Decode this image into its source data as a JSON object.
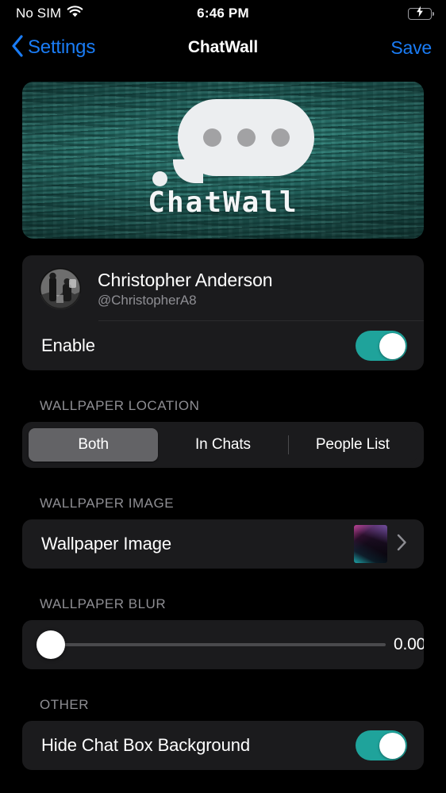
{
  "status_bar": {
    "carrier": "No SIM",
    "time": "6:46 PM",
    "wifi_icon": "wifi-icon",
    "battery_icon": "battery-charging-icon"
  },
  "nav": {
    "back_icon": "chevron-left-icon",
    "back_label": "Settings",
    "title": "ChatWall",
    "save_label": "Save"
  },
  "banner": {
    "wordmark": "ChatWall",
    "bubble_icon": "speech-bubble-icon",
    "dots": [
      "",
      "",
      ""
    ]
  },
  "account": {
    "avatar_icon": "avatar",
    "name": "Christopher Anderson",
    "handle": "@ChristopherA8",
    "enable_label": "Enable",
    "enable_on": true
  },
  "sections": {
    "wallpaper_location": {
      "header": "WALLPAPER LOCATION",
      "options": [
        "Both",
        "In Chats",
        "People List"
      ],
      "selected": "Both"
    },
    "wallpaper_image": {
      "header": "WALLPAPER IMAGE",
      "row_label": "Wallpaper Image",
      "thumbnail_icon": "wallpaper-thumbnail",
      "disclosure_icon": "chevron-right-icon"
    },
    "wallpaper_blur": {
      "header": "WALLPAPER BLUR",
      "value": "0.00",
      "slider_percent": 0
    },
    "other": {
      "header": "OTHER",
      "hide_chat_box_label": "Hide Chat Box Background",
      "hide_chat_box_on": true
    }
  },
  "colors": {
    "accent_blue": "#1a7cf5",
    "toggle_teal": "#1fa39b",
    "battery_green": "#2fd158",
    "card_bg": "#1b1b1d",
    "section_header": "#8e8e93"
  }
}
